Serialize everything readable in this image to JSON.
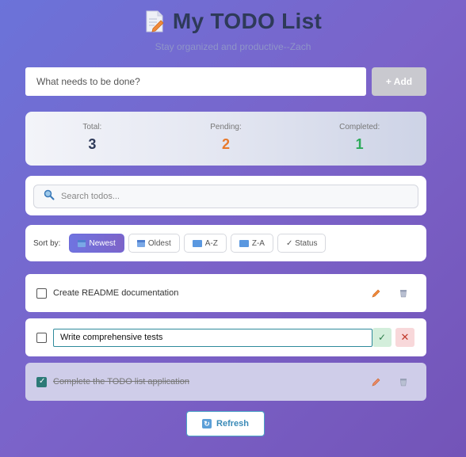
{
  "header": {
    "title": "My TODO List",
    "subtitle": "Stay organized and productive--Zach",
    "icon": "memo-icon"
  },
  "add_form": {
    "placeholder": "What needs to be done?",
    "button_label": "+ Add"
  },
  "stats": [
    {
      "label": "Total:",
      "value": "3",
      "color": "#2e3a59"
    },
    {
      "label": "Pending:",
      "value": "2",
      "color": "#e87a2c"
    },
    {
      "label": "Completed:",
      "value": "1",
      "color": "#2eaa5a"
    }
  ],
  "search": {
    "placeholder": "Search todos...",
    "icon": "search-icon"
  },
  "sort": {
    "label": "Sort by:",
    "options": [
      {
        "label": "Newest",
        "active": true,
        "icon": "calendar-icon"
      },
      {
        "label": "Oldest",
        "active": false,
        "icon": "calendar-icon"
      },
      {
        "label": "A-Z",
        "active": false,
        "icon": "abc-icon"
      },
      {
        "label": "Z-A",
        "active": false,
        "icon": "abc-icon"
      },
      {
        "label": "✓ Status",
        "active": false,
        "icon": ""
      }
    ]
  },
  "todos": [
    {
      "text": "Create README documentation",
      "completed": false,
      "editing": false
    },
    {
      "text": "Write comprehensive tests",
      "completed": false,
      "editing": true
    },
    {
      "text": "Complete the TODO list application",
      "completed": true,
      "editing": false
    }
  ],
  "refresh": {
    "label": "Refresh",
    "icon": "refresh-icon"
  },
  "colors": {
    "accent": "#6f74e0",
    "pending": "#e87a2c",
    "completed": "#2eaa5a"
  }
}
